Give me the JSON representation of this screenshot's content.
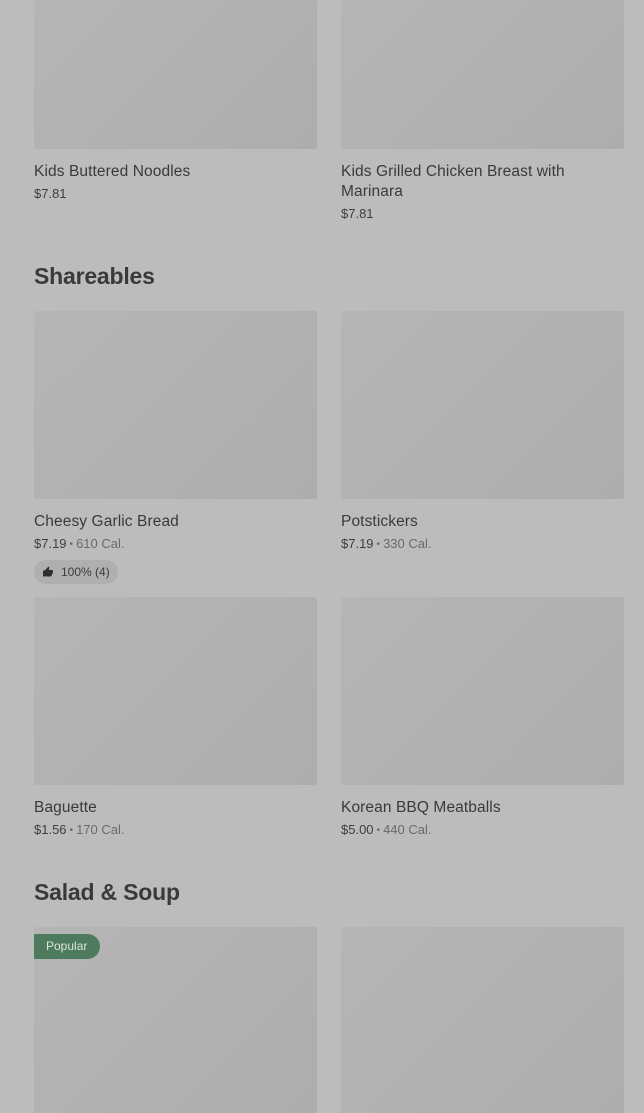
{
  "kids": {
    "items": [
      {
        "name": "Kids Buttered Noodles",
        "price": "$7.81"
      },
      {
        "name": "Kids Grilled Chicken Breast with Marinara",
        "price": "$7.81"
      }
    ]
  },
  "shareables": {
    "title": "Shareables",
    "items": [
      {
        "name": "Cheesy Garlic Bread",
        "price": "$7.19",
        "calories": "610 Cal.",
        "rating": "100% (4)"
      },
      {
        "name": "Potstickers",
        "price": "$7.19",
        "calories": "330 Cal."
      },
      {
        "name": "Baguette",
        "price": "$1.56",
        "calories": "170 Cal."
      },
      {
        "name": "Korean BBQ Meatballs",
        "price": "$5.00",
        "calories": "440 Cal."
      }
    ]
  },
  "salad_soup": {
    "title": "Salad & Soup",
    "items": [
      {
        "badge": "Popular"
      }
    ]
  },
  "separator": "•",
  "icons": {
    "thumbs_up": "thumbs-up-icon"
  },
  "colors": {
    "background": "#bcbcbc",
    "image_placeholder": "#b0b0b0",
    "popular_badge": "#4e7a5e",
    "rating_pill": "#afafaf"
  }
}
